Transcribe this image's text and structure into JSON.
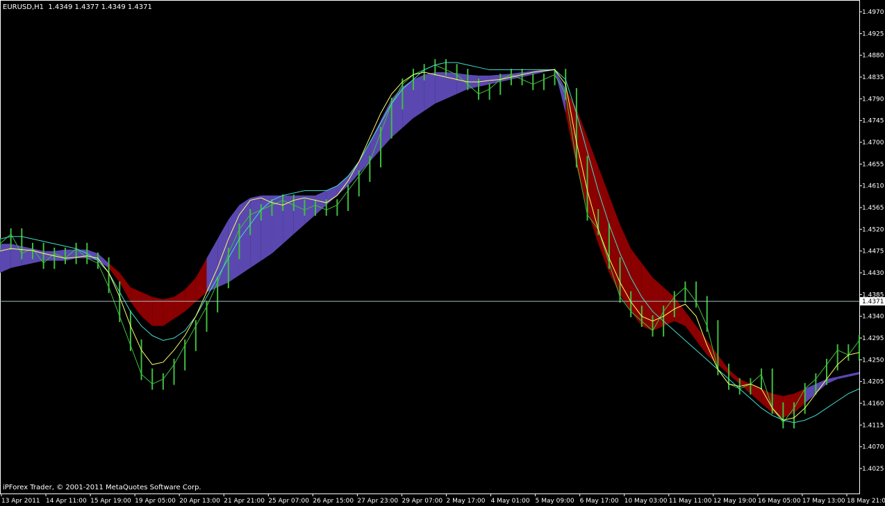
{
  "header": {
    "symbol": "EURUSD,H1",
    "ohlc": "1.4349 1.4377 1.4349 1.4371"
  },
  "footer": {
    "copyright": "iPForex Trader, © 2001-2011 MetaQuotes Software Corp."
  },
  "colors": {
    "background": "#000000",
    "grid": "#ffffff",
    "price": "#3fbf3f",
    "cloud_up": "#5a48b0",
    "cloud_down": "#8b0000",
    "fast_ma": "#ffff66",
    "slow_ma": "#40e0d0",
    "current_line": "#9fc4c4"
  },
  "chart_data": {
    "type": "line",
    "title": "EURUSD,H1",
    "current_price": "1.4371",
    "y_ticks": [
      "1.4970",
      "1.4925",
      "1.4880",
      "1.4835",
      "1.4790",
      "1.4745",
      "1.4700",
      "1.4655",
      "1.4610",
      "1.4565",
      "1.4520",
      "1.4475",
      "1.4430",
      "1.4385",
      "1.4340",
      "1.4295",
      "1.4250",
      "1.4205",
      "1.4160",
      "1.4115",
      "1.4070",
      "1.4025"
    ],
    "x_ticks": [
      "13 Apr 2011",
      "14 Apr 11:00",
      "15 Apr 19:00",
      "19 Apr 05:00",
      "20 Apr 13:00",
      "21 Apr 21:00",
      "25 Apr 07:00",
      "26 Apr 15:00",
      "27 Apr 23:00",
      "29 Apr 07:00",
      "2 May 17:00",
      "4 May 01:00",
      "5 May 09:00",
      "6 May 17:00",
      "10 May 03:00",
      "11 May 11:00",
      "12 May 19:00",
      "16 May 05:00",
      "17 May 13:00",
      "18 May 21:00"
    ],
    "ylim": [
      1.4025,
      1.497
    ],
    "price": [
      1.449,
      1.451,
      1.447,
      1.448,
      1.445,
      1.447,
      1.446,
      1.448,
      1.446,
      1.445,
      1.44,
      1.434,
      1.428,
      1.422,
      1.42,
      1.421,
      1.424,
      1.428,
      1.432,
      1.436,
      1.441,
      1.447,
      1.452,
      1.455,
      1.456,
      1.457,
      1.458,
      1.457,
      1.456,
      1.457,
      1.456,
      1.457,
      1.46,
      1.463,
      1.466,
      1.472,
      1.478,
      1.482,
      1.484,
      1.485,
      1.486,
      1.485,
      1.484,
      1.482,
      1.48,
      1.481,
      1.483,
      1.484,
      1.483,
      1.482,
      1.483,
      1.484,
      1.48,
      1.466,
      1.455,
      1.452,
      1.445,
      1.438,
      1.435,
      1.433,
      1.431,
      1.435,
      1.438,
      1.44,
      1.437,
      1.432,
      1.423,
      1.42,
      1.419,
      1.42,
      1.422,
      1.415,
      1.412,
      1.415,
      1.419,
      1.421,
      1.424,
      1.427,
      1.426,
      1.429
    ],
    "fast_ma": [
      1.4475,
      1.448,
      1.4478,
      1.4476,
      1.447,
      1.4465,
      1.446,
      1.4462,
      1.4465,
      1.446,
      1.443,
      1.438,
      1.432,
      1.427,
      1.424,
      1.4245,
      1.427,
      1.43,
      1.434,
      1.439,
      1.444,
      1.45,
      1.455,
      1.458,
      1.4585,
      1.4575,
      1.457,
      1.458,
      1.4585,
      1.458,
      1.4575,
      1.459,
      1.462,
      1.466,
      1.471,
      1.476,
      1.48,
      1.4825,
      1.484,
      1.4845,
      1.484,
      1.4835,
      1.483,
      1.4825,
      1.4825,
      1.4828,
      1.483,
      1.4835,
      1.484,
      1.4845,
      1.4848,
      1.485,
      1.482,
      1.47,
      1.46,
      1.452,
      1.446,
      1.441,
      1.437,
      1.434,
      1.433,
      1.434,
      1.4355,
      1.4365,
      1.434,
      1.428,
      1.423,
      1.42,
      1.4195,
      1.42,
      1.419,
      1.415,
      1.4125,
      1.413,
      1.415,
      1.418,
      1.421,
      1.424,
      1.426,
      1.4265
    ],
    "slow_ma": [
      1.45,
      1.4505,
      1.4505,
      1.45,
      1.4495,
      1.449,
      1.4485,
      1.448,
      1.447,
      1.4455,
      1.443,
      1.439,
      1.435,
      1.432,
      1.43,
      1.429,
      1.4295,
      1.431,
      1.434,
      1.438,
      1.442,
      1.446,
      1.45,
      1.453,
      1.456,
      1.458,
      1.459,
      1.4595,
      1.46,
      1.46,
      1.46,
      1.461,
      1.463,
      1.466,
      1.47,
      1.474,
      1.478,
      1.481,
      1.483,
      1.485,
      1.486,
      1.4865,
      1.4865,
      1.486,
      1.4855,
      1.485,
      1.485,
      1.485,
      1.485,
      1.485,
      1.485,
      1.485,
      1.483,
      1.476,
      1.468,
      1.46,
      1.453,
      1.447,
      1.442,
      1.438,
      1.435,
      1.433,
      1.431,
      1.429,
      1.427,
      1.425,
      1.423,
      1.421,
      1.419,
      1.417,
      1.415,
      1.4135,
      1.4125,
      1.412,
      1.4125,
      1.4135,
      1.415,
      1.4165,
      1.418,
      1.419
    ],
    "cloud_upper": [
      1.449,
      1.449,
      1.4485,
      1.448,
      1.4475,
      1.4475,
      1.4478,
      1.4478,
      1.4478,
      1.447,
      1.445,
      1.443,
      1.44,
      1.439,
      1.438,
      1.4375,
      1.438,
      1.4395,
      1.442,
      1.446,
      1.45,
      1.454,
      1.457,
      1.4585,
      1.459,
      1.459,
      1.459,
      1.459,
      1.459,
      1.459,
      1.46,
      1.461,
      1.463,
      1.466,
      1.47,
      1.4745,
      1.479,
      1.4815,
      1.483,
      1.484,
      1.4845,
      1.4845,
      1.4843,
      1.484,
      1.4838,
      1.4838,
      1.484,
      1.4842,
      1.4845,
      1.4848,
      1.485,
      1.4852,
      1.481,
      1.477,
      1.471,
      1.465,
      1.459,
      1.453,
      1.448,
      1.445,
      1.442,
      1.44,
      1.438,
      1.435,
      1.432,
      1.429,
      1.426,
      1.423,
      1.421,
      1.42,
      1.419,
      1.418,
      1.4175,
      1.418,
      1.419,
      1.42,
      1.421,
      1.4215,
      1.422,
      1.4225
    ],
    "cloud_lower": [
      1.443,
      1.444,
      1.4445,
      1.445,
      1.4455,
      1.4455,
      1.4455,
      1.446,
      1.446,
      1.4455,
      1.444,
      1.441,
      1.437,
      1.434,
      1.432,
      1.432,
      1.4335,
      1.435,
      1.437,
      1.439,
      1.44,
      1.441,
      1.4425,
      1.444,
      1.4455,
      1.447,
      1.449,
      1.451,
      1.453,
      1.455,
      1.457,
      1.459,
      1.461,
      1.4635,
      1.466,
      1.4685,
      1.471,
      1.473,
      1.475,
      1.4765,
      1.478,
      1.479,
      1.48,
      1.481,
      1.4815,
      1.482,
      1.4825,
      1.483,
      1.4835,
      1.484,
      1.4845,
      1.485,
      1.476,
      1.465,
      1.456,
      1.449,
      1.443,
      1.4385,
      1.435,
      1.432,
      1.431,
      1.432,
      1.433,
      1.432,
      1.429,
      1.426,
      1.424,
      1.422,
      1.42,
      1.418,
      1.416,
      1.414,
      1.413,
      1.414,
      1.416,
      1.418,
      1.42,
      1.421,
      1.4215,
      1.422
    ],
    "cloud_color_by_segment": [
      "up",
      "up",
      "up",
      "up",
      "up",
      "up",
      "up",
      "up",
      "up",
      "up",
      "down",
      "down",
      "down",
      "down",
      "down",
      "down",
      "down",
      "down",
      "down",
      "up",
      "up",
      "up",
      "up",
      "up",
      "up",
      "up",
      "up",
      "up",
      "up",
      "up",
      "up",
      "up",
      "up",
      "up",
      "up",
      "up",
      "up",
      "up",
      "up",
      "up",
      "up",
      "up",
      "up",
      "up",
      "up",
      "up",
      "up",
      "up",
      "up",
      "up",
      "up",
      "up",
      "down",
      "down",
      "down",
      "down",
      "down",
      "down",
      "down",
      "down",
      "down",
      "down",
      "down",
      "down",
      "down",
      "down",
      "down",
      "down",
      "down",
      "down",
      "down",
      "down",
      "down",
      "down",
      "up",
      "up",
      "up",
      "up",
      "up",
      "up"
    ],
    "grid": false,
    "legend": "none"
  }
}
